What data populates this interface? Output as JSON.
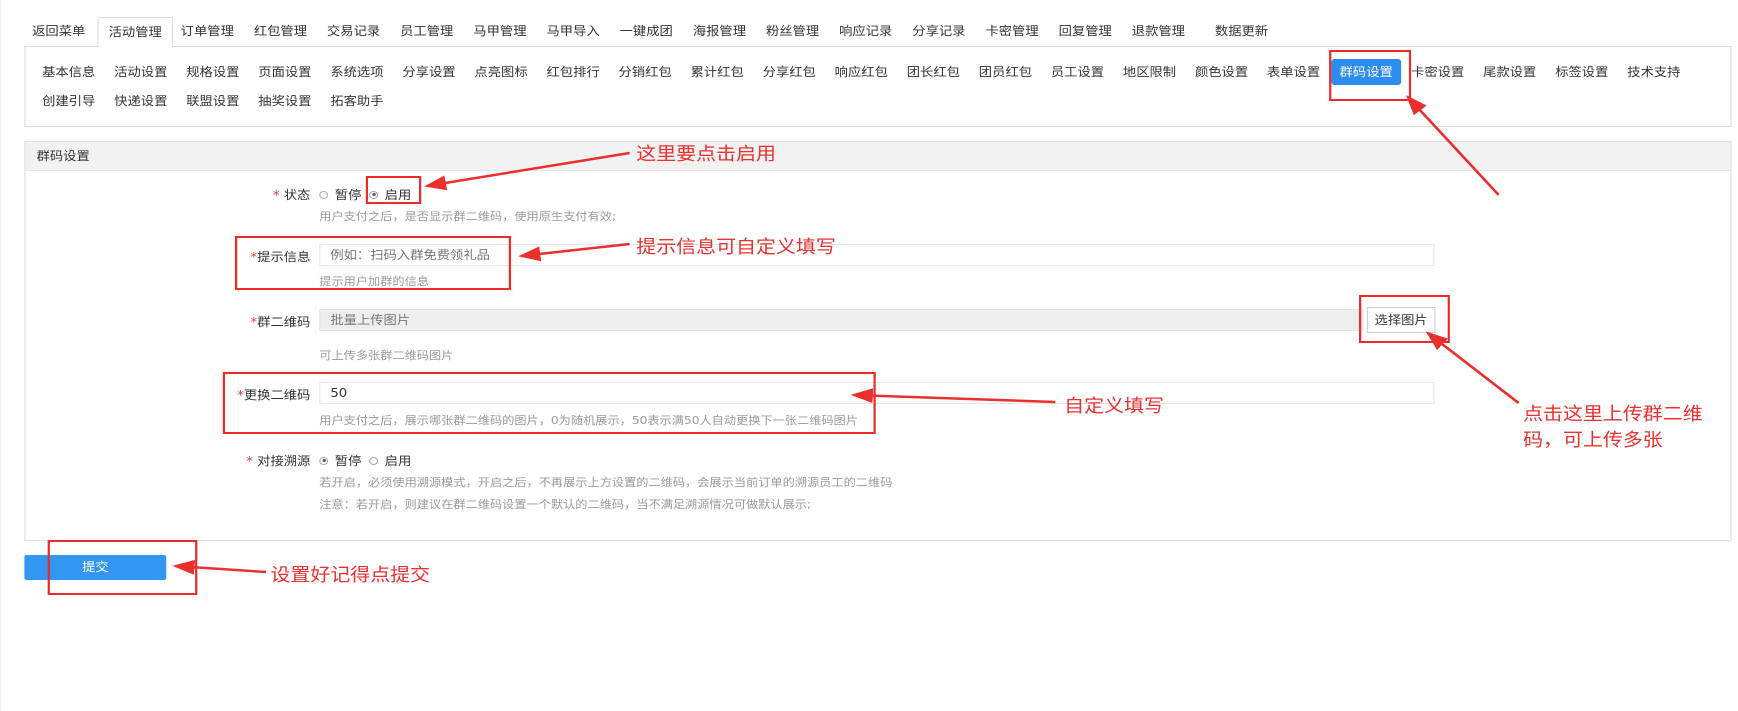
{
  "top_tabs": [
    {
      "label": "返回菜单"
    },
    {
      "label": "活动管理",
      "active": true
    },
    {
      "label": "订单管理"
    },
    {
      "label": "红包管理"
    },
    {
      "label": "交易记录"
    },
    {
      "label": "员工管理"
    },
    {
      "label": "马甲管理"
    },
    {
      "label": "马甲导入"
    },
    {
      "label": "一键成团"
    },
    {
      "label": "海报管理"
    },
    {
      "label": "粉丝管理"
    },
    {
      "label": "响应记录"
    },
    {
      "label": "分享记录"
    },
    {
      "label": "卡密管理"
    },
    {
      "label": "回复管理"
    },
    {
      "label": "退款管理"
    },
    {
      "label": "数据更新"
    }
  ],
  "sub_tabs": [
    {
      "label": "基本信息"
    },
    {
      "label": "活动设置"
    },
    {
      "label": "规格设置"
    },
    {
      "label": "页面设置"
    },
    {
      "label": "系统选项"
    },
    {
      "label": "分享设置"
    },
    {
      "label": "点亮图标"
    },
    {
      "label": "红包排行"
    },
    {
      "label": "分销红包"
    },
    {
      "label": "累计红包"
    },
    {
      "label": "分享红包"
    },
    {
      "label": "响应红包"
    },
    {
      "label": "团长红包"
    },
    {
      "label": "团员红包"
    },
    {
      "label": "员工设置"
    },
    {
      "label": "地区限制"
    },
    {
      "label": "颜色设置"
    },
    {
      "label": "表单设置"
    },
    {
      "label": "群码设置",
      "active": true
    },
    {
      "label": "卡密设置"
    },
    {
      "label": "尾款设置"
    },
    {
      "label": "标签设置"
    },
    {
      "label": "技术支持"
    },
    {
      "label": "创建引导"
    },
    {
      "label": "快递设置"
    },
    {
      "label": "联盟设置"
    },
    {
      "label": "抽奖设置"
    },
    {
      "label": "拓客助手"
    }
  ],
  "section": {
    "title": "群码设置"
  },
  "form": {
    "status": {
      "label": "状态",
      "options": [
        "暂停",
        "启用"
      ],
      "selected": "启用",
      "help": "用户支付之后，是否显示群二维码，使用原生支付有效;"
    },
    "tip": {
      "label": "提示信息",
      "placeholder": "例如：扫码入群免费领礼品",
      "value": "",
      "help": "提示用户加群的信息"
    },
    "qrcode": {
      "label": "群二维码",
      "placeholder": "批量上传图片",
      "button": "选择图片",
      "help": "可上传多张群二维码图片"
    },
    "swap": {
      "label": "更换二维码",
      "value": "50",
      "help": "用户支付之后，展示哪张群二维码的图片，0为随机展示，50表示满50人自动更换下一张二维码图片"
    },
    "trace": {
      "label": "对接溯源",
      "options": [
        "暂停",
        "启用"
      ],
      "selected": "暂停",
      "help1": "若开启，必须使用溯源模式，开启之后，不再展示上方设置的二维码，会展示当前订单的溯源员工的二维码",
      "help2": "注意：若开启，则建议在群二维码设置一个默认的二维码，当不满足溯源情况可做默认展示;"
    }
  },
  "submit_label": "提交",
  "annotations": {
    "enable": "这里要点击启用",
    "tip": "提示信息可自定义填写",
    "custom": "自定义填写",
    "upload_line1": "点击这里上传群二维",
    "upload_line2": "码，可上传多张",
    "submit": "设置好记得点提交"
  },
  "colors": {
    "accent": "#2d8cf0",
    "annotation": "#ea2f2f",
    "required": "#e4393c"
  }
}
